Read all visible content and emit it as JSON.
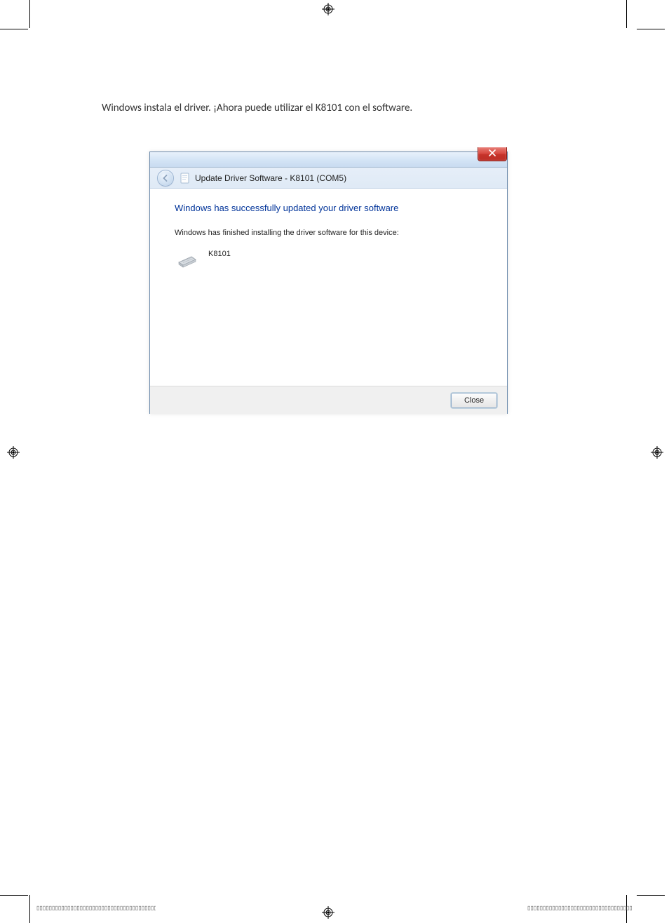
{
  "page": {
    "text": "Windows instala el driver. ¡Ahora puede utilizar el K8101 con el software."
  },
  "dialog": {
    "close_x": "✕",
    "nav_title": "Update Driver Software - K8101 (COM5)",
    "heading": "Windows has successfully updated your driver software",
    "body_text": "Windows has finished installing the driver software for this device:",
    "device_name": "K8101",
    "close_button": "Close"
  },
  "footer": {
    "dotted": "▯▯▯▯▯▯▯▯▯▯▯▯▯▯▯▯▯▯▯▯▯▯▯▯▯▯▯▯▯▯▯▯▯▯▯▯▯▯▯▯▯▯▯▯▯▯▯▯▯▯▯▯▯▯▯▯▯▯"
  }
}
